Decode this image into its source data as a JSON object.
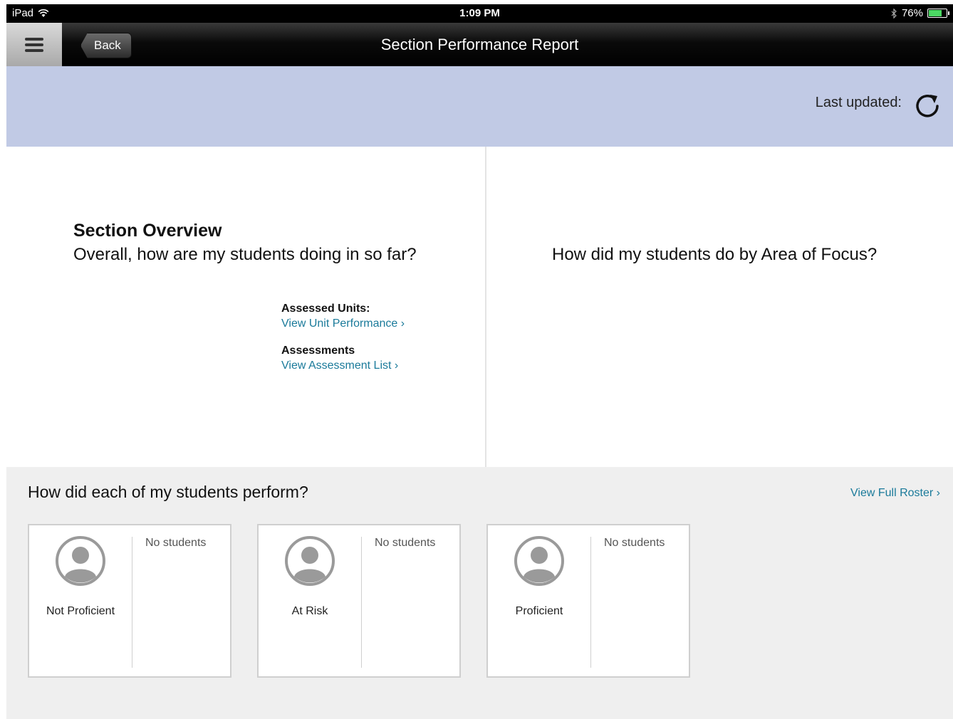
{
  "status_bar": {
    "device": "iPad",
    "time": "1:09 PM",
    "battery": "76%",
    "battery_level": 0.76
  },
  "nav": {
    "back_label": "Back",
    "title": "Section Performance Report"
  },
  "info_band": {
    "last_updated_label": "Last updated:"
  },
  "overview": {
    "title": "Section Overview",
    "subtitle": "Overall, how are my students doing in so far?",
    "units_label": "Assessed Units:",
    "units_link": "View Unit Performance ›",
    "assessments_label": "Assessments",
    "assessments_link": "View Assessment List ›"
  },
  "focus": {
    "question": "How did my students do by Area of Focus?"
  },
  "students": {
    "question": "How did each of my students perform?",
    "roster_link": "View Full Roster ›",
    "cards": [
      {
        "category": "Not Proficient",
        "empty_text": "No students"
      },
      {
        "category": "At Risk",
        "empty_text": "No students"
      },
      {
        "category": "Proficient",
        "empty_text": "No students"
      }
    ]
  }
}
